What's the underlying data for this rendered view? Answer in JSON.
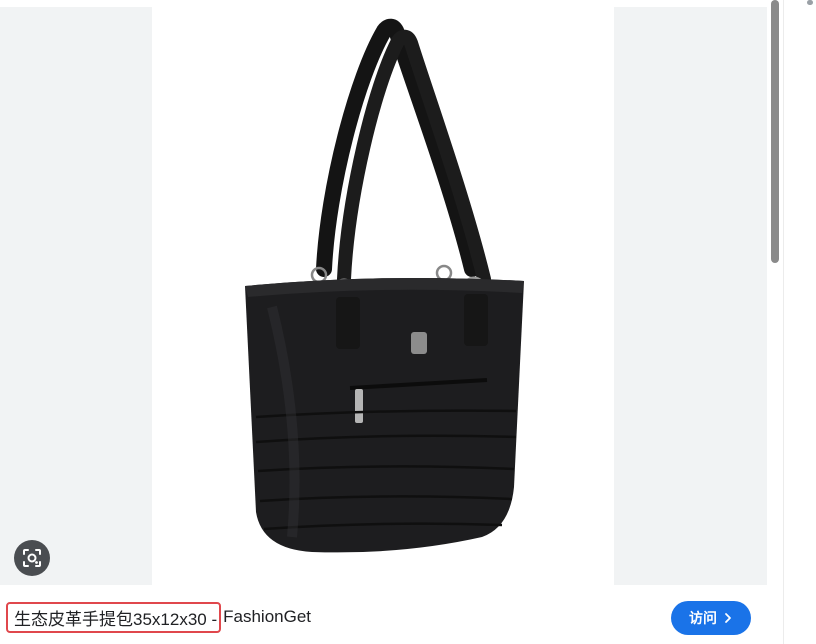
{
  "caption": {
    "title": "生态皮革手提包35x12x30 - FashionGet",
    "title_highlighted": "生态皮革手提包35x12x30 -",
    "title_site": "FashionGet"
  },
  "visit_button": {
    "label": "访问",
    "icon": "chevron-right-icon"
  },
  "lens_button": {
    "icon": "lens-search-icon"
  },
  "image": {
    "subject": "black-leather-tote-bag"
  },
  "colors": {
    "panel_background": "#f1f3f4",
    "highlight_border": "#e0474c",
    "visit_button": "#1a73e8",
    "lens_button": "#4a4d51",
    "scroll_thumb": "#8a8a8a"
  }
}
